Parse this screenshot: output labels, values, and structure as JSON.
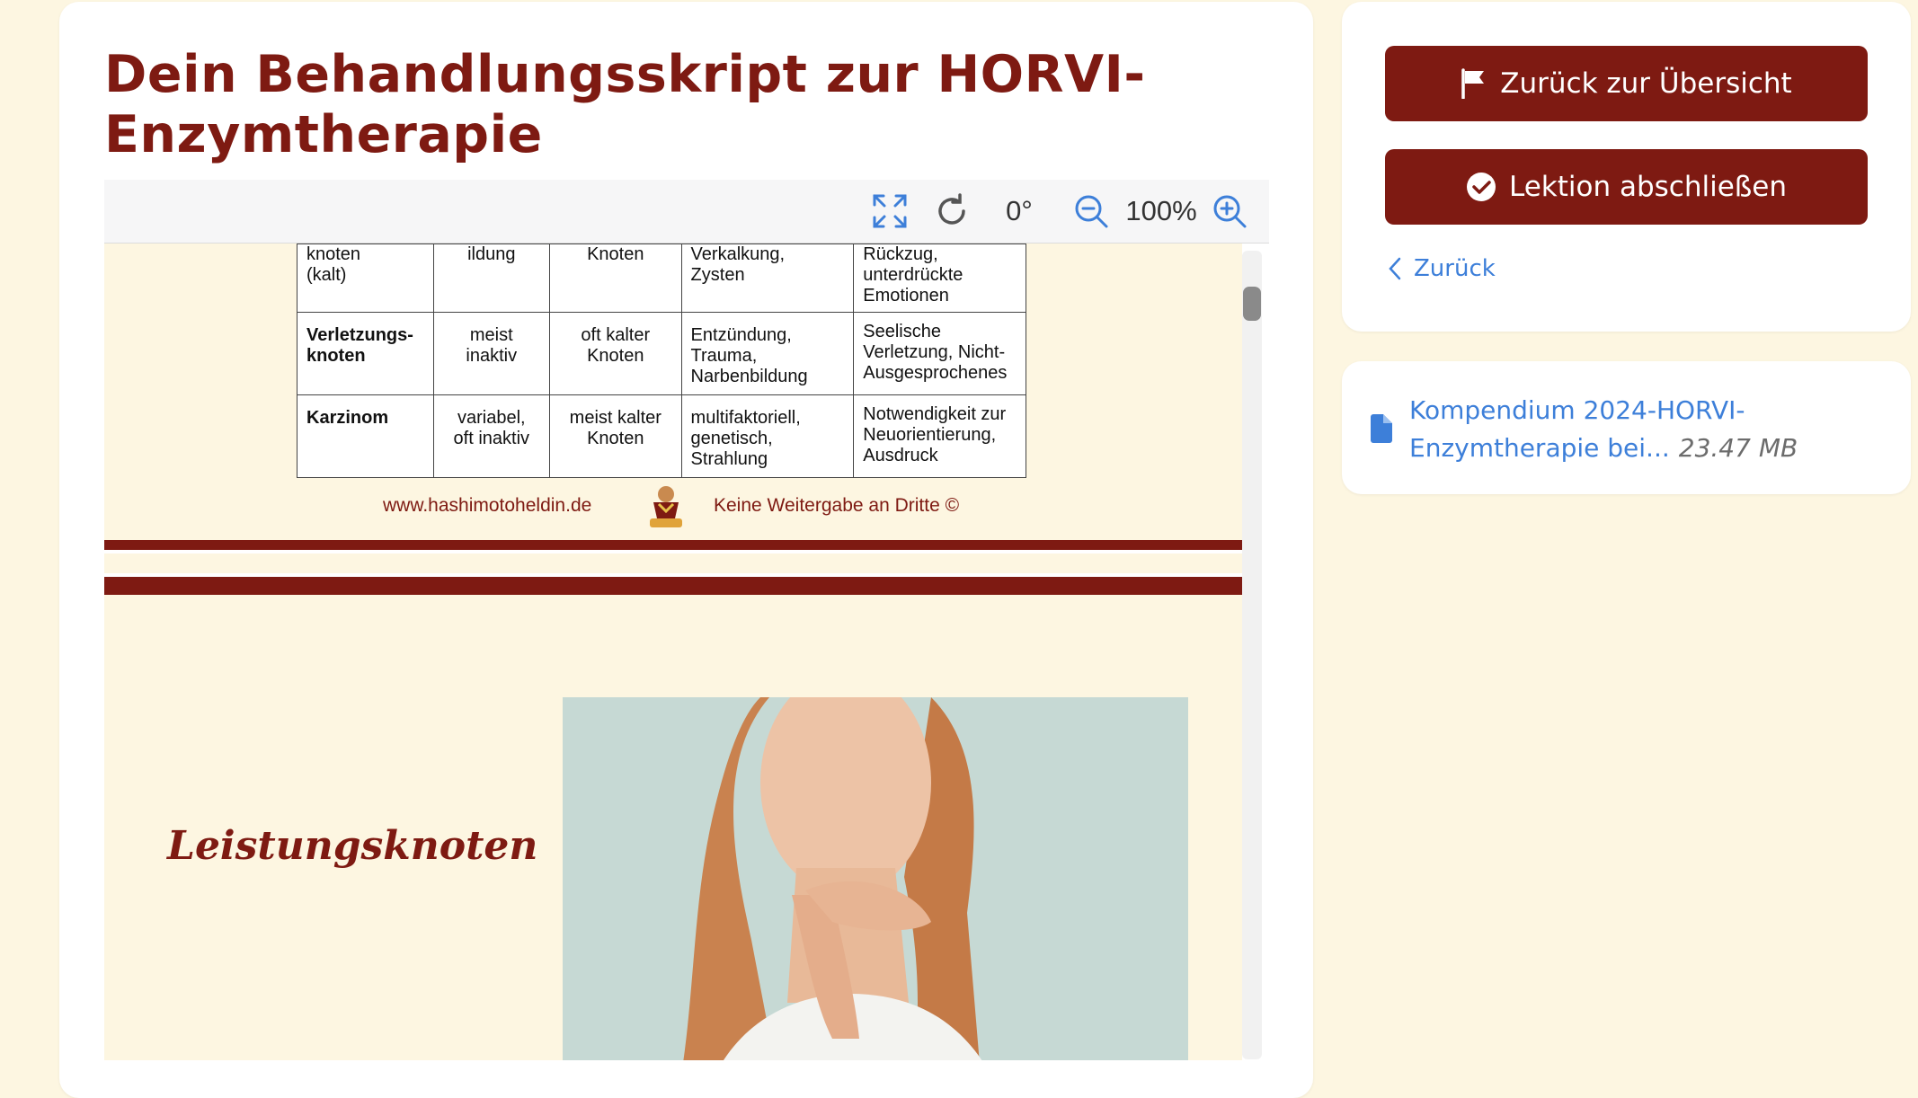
{
  "lesson": {
    "title": "Dein Behandlungsskript zur HORVI-Enzymtherapie"
  },
  "viewer": {
    "toolbar": {
      "fullscreen_icon": "expand-icon",
      "rotate_icon": "rotate-icon",
      "rotation": "0°",
      "zoom_out_icon": "zoom-out-icon",
      "zoom": "100%",
      "zoom_in_icon": "zoom-in-icon"
    },
    "table_rows": [
      [
        "knoten\n(kalt)",
        "ildung",
        "Knoten",
        "Verkalkung,\nZysten",
        "Rückzug,\nunterdrückte\nEmotionen"
      ],
      [
        "Verletzungs-\nknoten",
        "meist\ninaktiv",
        "oft kalter\nKnoten",
        "Entzündung,\nTrauma,\nNarbenbildung",
        "Seelische\nVerletzung, Nicht-\nAusgesprochenes"
      ],
      [
        "Karzinom",
        "variabel,\noft inaktiv",
        "meist kalter\nKnoten",
        "multifaktoriell,\ngenetisch,\nStrahlung",
        "Notwendigkeit zur\nNeuorientierung,\nAusdruck"
      ]
    ],
    "footer": {
      "website": "www.hashimotoheldin.de",
      "notice": "Keine Weitergabe an Dritte ©"
    },
    "next_page": {
      "heading": "Leistungsknoten"
    }
  },
  "sidebar": {
    "overview_button": "Zurück zur Übersicht",
    "complete_button": "Lektion abschließen",
    "back_link": "Zurück"
  },
  "attachment": {
    "name": "Kompendium 2024-HORVI-Enzymtherapie bei...",
    "size": "23.47 MB"
  },
  "colors": {
    "brand": "#7e1a12",
    "background": "#fdf6e1",
    "link": "#3d7fd9"
  }
}
